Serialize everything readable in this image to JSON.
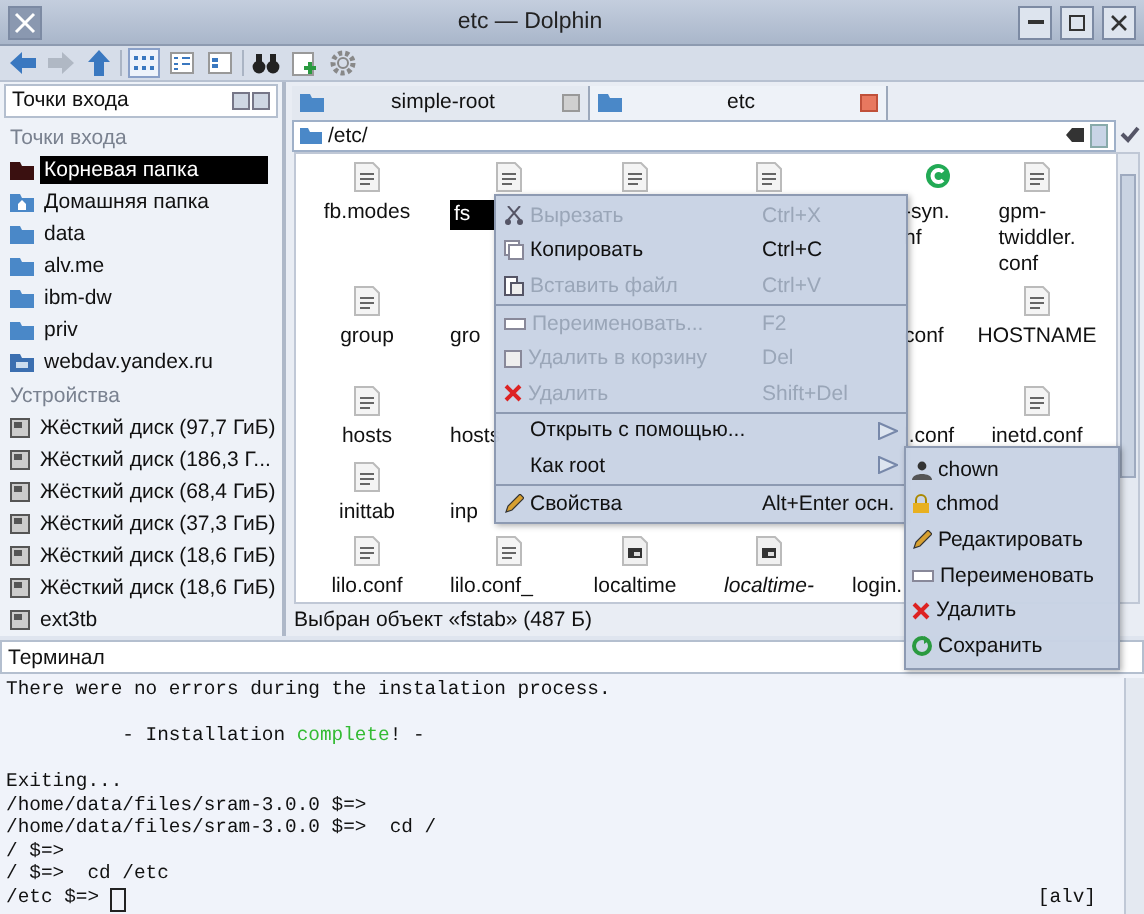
{
  "window": {
    "title": "etc — Dolphin"
  },
  "places_panel": {
    "title": "Точки входа",
    "sections": [
      {
        "title": "Точки входа",
        "items": [
          {
            "label": "Корневая папка",
            "kind": "root",
            "selected": true
          },
          {
            "label": "Домашняя папка",
            "kind": "home",
            "selected": false
          },
          {
            "label": "data",
            "kind": "folder",
            "selected": false
          },
          {
            "label": "alv.me",
            "kind": "folder",
            "selected": false
          },
          {
            "label": "ibm-dw",
            "kind": "folder",
            "selected": false
          },
          {
            "label": "priv",
            "kind": "folder",
            "selected": false
          },
          {
            "label": "webdav.yandex.ru",
            "kind": "network",
            "selected": false
          }
        ]
      },
      {
        "title": "Устройства",
        "items": [
          {
            "label": "Жёсткий диск (97,7 ГиБ)",
            "kind": "drive",
            "selected": false
          },
          {
            "label": "Жёсткий диск (186,3 Г...",
            "kind": "drive",
            "selected": false
          },
          {
            "label": "Жёсткий диск (68,4 ГиБ)",
            "kind": "drive",
            "selected": false
          },
          {
            "label": "Жёсткий диск (37,3 ГиБ)",
            "kind": "drive",
            "selected": false
          },
          {
            "label": "Жёсткий диск (18,6 ГиБ)",
            "kind": "drive",
            "selected": false
          },
          {
            "label": "Жёсткий диск (18,6 ГиБ)",
            "kind": "drive",
            "selected": false
          },
          {
            "label": "ext3tb",
            "kind": "drive",
            "selected": false
          }
        ]
      }
    ]
  },
  "tabs": [
    {
      "label": "simple-root",
      "selected": false
    },
    {
      "label": "etc",
      "selected": true
    }
  ],
  "address": {
    "value": "/etc/"
  },
  "files": [
    [
      {
        "kind": "text",
        "name": "fb.modes",
        "selected": false
      },
      {
        "kind": "text",
        "name": "fs",
        "selected": true
      },
      {
        "kind": "text"
      },
      {
        "kind": "text"
      },
      {
        "kind": "script",
        "name": "-syn.\nnf",
        "selected": false
      },
      {
        "kind": "text",
        "name": "gpm-\ntwiddler.\nconf",
        "selected": false
      }
    ],
    [
      {
        "kind": "text",
        "name": "group",
        "selected": false
      },
      {
        "kind": "bare",
        "name": "gro",
        "selected": false
      },
      {
        "kind": "hidden"
      },
      {
        "kind": "hidden"
      },
      {
        "kind": "bare",
        "name": "conf",
        "selected": false
      },
      {
        "kind": "text",
        "name": "HOSTNAME",
        "selected": false
      }
    ],
    [
      {
        "kind": "text",
        "name": "hosts",
        "selected": false
      },
      {
        "kind": "bare",
        "name": "hosts",
        "selected": false
      },
      {
        "kind": "hidden"
      },
      {
        "kind": "hidden"
      },
      {
        "kind": "bare",
        "name": "l.conf",
        "selected": false
      },
      {
        "kind": "text",
        "name": "inetd.conf",
        "selected": false
      }
    ],
    [
      {
        "kind": "text",
        "name": "inittab",
        "selected": false
      },
      {
        "kind": "bare",
        "name": "inp",
        "selected": false
      },
      {
        "kind": "hidden"
      },
      {
        "kind": "hidden"
      },
      {
        "kind": "hidden"
      },
      {
        "kind": "hidden"
      }
    ],
    [
      {
        "kind": "text",
        "name": "lilo.conf",
        "selected": false
      },
      {
        "kind": "text",
        "name": "lilo.conf_",
        "selected": false
      },
      {
        "kind": "binary",
        "name": "localtime",
        "selected": false
      },
      {
        "kind": "binary",
        "name": "localtime-",
        "link": true,
        "selected": false
      },
      {
        "kind": "bare",
        "name": "login.",
        "selected": false
      },
      {
        "kind": "hidden"
      }
    ]
  ],
  "status": "Выбран объект «fstab» (487 Б)",
  "context_menu": {
    "items": [
      {
        "kind": "item",
        "label": "Вырезать",
        "shortcut": "Ctrl+X",
        "disabled": true
      },
      {
        "kind": "item",
        "label": "Копировать",
        "shortcut": "Ctrl+C",
        "disabled": false
      },
      {
        "kind": "item",
        "label": "Вставить файл",
        "shortcut": "Ctrl+V",
        "disabled": true
      },
      {
        "kind": "separator"
      },
      {
        "kind": "item",
        "label": "Переименовать...",
        "shortcut": "F2",
        "disabled": true
      },
      {
        "kind": "item",
        "label": "Удалить в корзину",
        "shortcut": "Del",
        "disabled": true
      },
      {
        "kind": "item",
        "label": "Удалить",
        "shortcut": "Shift+Del",
        "disabled": true
      },
      {
        "kind": "separator"
      },
      {
        "kind": "submenu",
        "label": "Открыть с помощью...",
        "disabled": false
      },
      {
        "kind": "submenu",
        "label": "Как root",
        "disabled": false
      },
      {
        "kind": "separator"
      },
      {
        "kind": "item",
        "label": "Свойства",
        "shortcut": "Alt+Enter осн.",
        "disabled": false
      }
    ]
  },
  "submenu": {
    "items": [
      {
        "label": "chown"
      },
      {
        "label": "chmod"
      },
      {
        "label": "Редактировать"
      },
      {
        "label": "Переименовать"
      },
      {
        "label": "Удалить"
      },
      {
        "label": "Сохранить"
      }
    ]
  },
  "terminal": {
    "title": "Терминал",
    "tag": "[alv]",
    "lines": [
      {
        "kind": "text",
        "segments": [
          {
            "text": "There were no errors during the instalation process."
          }
        ]
      },
      {
        "kind": "blank"
      },
      {
        "kind": "text",
        "segments": [
          {
            "text": "          - Installation "
          },
          {
            "text": "complete",
            "color": "#33bb33"
          },
          {
            "text": "! -"
          }
        ]
      },
      {
        "kind": "blank"
      },
      {
        "kind": "text",
        "segments": [
          {
            "text": "Exiting..."
          }
        ]
      },
      {
        "kind": "text",
        "segments": [
          {
            "text": "/home/data/files/sram-3.0.0 $=>"
          }
        ]
      },
      {
        "kind": "text",
        "segments": [
          {
            "text": "/home/data/files/sram-3.0.0 $=>  cd /"
          }
        ]
      },
      {
        "kind": "text",
        "segments": [
          {
            "text": "/ $=>"
          }
        ]
      },
      {
        "kind": "text",
        "segments": [
          {
            "text": "/ $=>  cd /etc"
          }
        ]
      },
      {
        "kind": "prompt",
        "segments": [
          {
            "text": "/etc $=> "
          }
        ]
      }
    ]
  }
}
